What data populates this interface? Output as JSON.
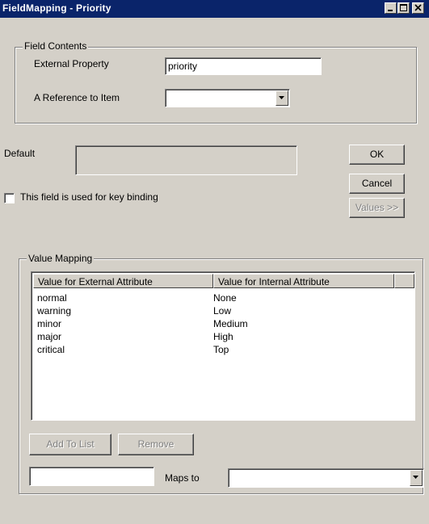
{
  "window": {
    "title": "FieldMapping - Priority"
  },
  "field_contents": {
    "legend": "Field Contents",
    "external_property_label": "External Property",
    "external_property_value": "priority",
    "reference_label": "A Reference to Item",
    "reference_value": ""
  },
  "default": {
    "label": "Default",
    "value": ""
  },
  "key_binding": {
    "label": "This field is used for key binding",
    "checked": false
  },
  "buttons": {
    "ok": "OK",
    "cancel": "Cancel",
    "values": "Values >>",
    "add_to_list": "Add To List",
    "remove": "Remove"
  },
  "value_mapping": {
    "legend": "Value Mapping",
    "columns": [
      "Value for External Attribute",
      "Value for Internal Attribute"
    ],
    "rows": [
      [
        "normal",
        "None"
      ],
      [
        "warning",
        "Low"
      ],
      [
        "minor",
        "Medium"
      ],
      [
        "major",
        "High"
      ],
      [
        "critical",
        "Top"
      ]
    ],
    "new_value": "",
    "maps_to_label": "Maps to",
    "maps_to_value": ""
  },
  "icons": {
    "minimize": "minimize-icon",
    "maximize": "maximize-icon",
    "close": "close-icon",
    "dropdown": "chevron-down-icon"
  }
}
